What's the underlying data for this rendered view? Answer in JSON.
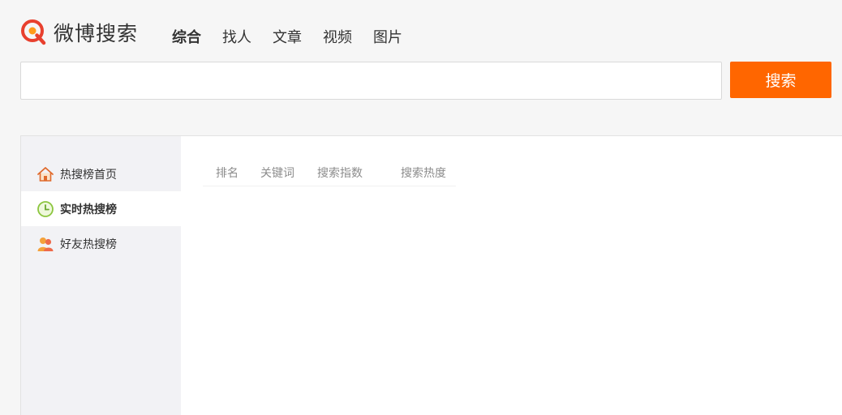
{
  "brand": {
    "name": "微博搜索",
    "accent_color": "#ff6600",
    "logo_icon": "weibo-search-logo-icon"
  },
  "nav": {
    "tabs": [
      {
        "label": "综合",
        "active": true
      },
      {
        "label": "找人",
        "active": false
      },
      {
        "label": "文章",
        "active": false
      },
      {
        "label": "视频",
        "active": false
      },
      {
        "label": "图片",
        "active": false
      }
    ]
  },
  "search": {
    "value": "",
    "placeholder": "",
    "button_label": "搜索"
  },
  "sidebar": {
    "items": [
      {
        "label": "热搜榜首页",
        "icon": "home-icon",
        "active": false
      },
      {
        "label": "实时热搜榜",
        "icon": "clock-icon",
        "active": true
      },
      {
        "label": "好友热搜榜",
        "icon": "friends-icon",
        "active": false
      }
    ]
  },
  "table": {
    "columns": [
      "排名",
      "关键词",
      "搜索指数",
      "搜索热度"
    ],
    "rows": []
  }
}
